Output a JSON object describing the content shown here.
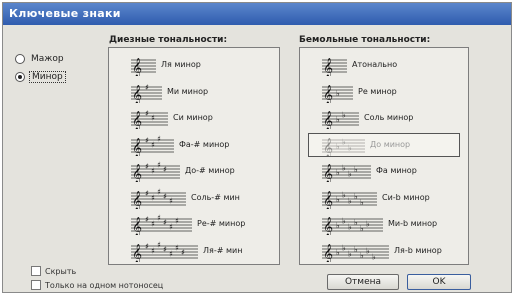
{
  "window": {
    "title": "Ключевые знаки"
  },
  "mode": {
    "options": [
      {
        "label": "Мажор",
        "checked": false
      },
      {
        "label": "Минор",
        "checked": true
      }
    ]
  },
  "sharps": {
    "title": "Диезные тональности:",
    "items": [
      {
        "label": "Ля минор",
        "accidentals": 0
      },
      {
        "label": "Ми минор",
        "accidentals": 1
      },
      {
        "label": "Си минор",
        "accidentals": 2
      },
      {
        "label": "Фа-# минор",
        "accidentals": 3
      },
      {
        "label": "До-# минор",
        "accidentals": 4
      },
      {
        "label": "Соль-# мин",
        "accidentals": 5
      },
      {
        "label": "Ре-# минор",
        "accidentals": 6
      },
      {
        "label": "Ля-# мин",
        "accidentals": 7
      }
    ]
  },
  "flats": {
    "title": "Бемольные тональности:",
    "selected_index": 3,
    "items": [
      {
        "label": "Атонально",
        "accidentals": 0
      },
      {
        "label": "Ре минор",
        "accidentals": 1
      },
      {
        "label": "Соль минор",
        "accidentals": 2
      },
      {
        "label": "До минор",
        "accidentals": 3
      },
      {
        "label": "Фа минор",
        "accidentals": 4
      },
      {
        "label": "Си-b минор",
        "accidentals": 5
      },
      {
        "label": "Ми-b минор",
        "accidentals": 6
      },
      {
        "label": "Ля-b минор",
        "accidentals": 7
      }
    ]
  },
  "options": {
    "hide_label": "Скрыть",
    "single_staff_label": "Только на одном нотоносец"
  },
  "buttons": {
    "cancel": "Отмена",
    "ok": "OK"
  }
}
